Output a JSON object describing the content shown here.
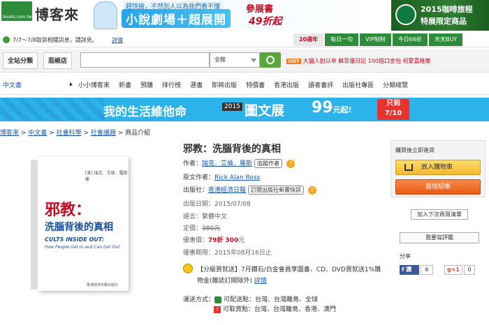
{
  "header": {
    "logo_small": "books.com.tw",
    "logo_text": "博客來",
    "promo_line1": "趕快搶，不然別人以為我們看不懂",
    "promo_line2": "小說劇場＋超展開",
    "promo_right1": "參展書",
    "promo_right2": "49折起",
    "starbucks_line1": "2015咖啡旅程",
    "starbucks_line2": "特展限定商品"
  },
  "notice": {
    "text": "7/7～7/8取貨相關訊息，請詳見。",
    "link": "詳情"
  },
  "toplinks": [
    "20週年",
    "每日一句",
    "VIP制制",
    "今日66折",
    "天天BUY"
  ],
  "search": {
    "category_button": "全站分類",
    "store_button": "逛帳店",
    "scope": "全館",
    "hot_label": "HOT",
    "hot_links": "大貓人創以帝  蘇菲僵日記  100個口金包  柯蒙嘉雞樂"
  },
  "nav": {
    "first": "中文書",
    "items": [
      "小小博客來",
      "新書",
      "預購",
      "排行榜",
      "選書",
      "即將出版",
      "特價書",
      "香港出版",
      "讀者書評",
      "出版社專區",
      "分類總覽"
    ]
  },
  "promo_banner": {
    "text1": "我的生活維他命",
    "year": "2015",
    "text2": "圖文展",
    "text3": "99",
    "text3_suffix": "元起!",
    "badge": "只到 7/10"
  },
  "breadcrumb": {
    "items": [
      "博客來",
      "中文書",
      "社會科學",
      "社會議題"
    ],
    "current": "商品介紹"
  },
  "book_cover": {
    "author_mini": "[美] 瑞克．艾倫．羅斯 著",
    "title_cn": "邪教：",
    "subtitle_cn": "洗腦背後的真相",
    "title_en": "CULTS INSIDE OUT:",
    "subtitle_en": "How People Get In and Can Get Out",
    "publisher_mini": "香港經濟日報出版社"
  },
  "product": {
    "title": "邪教：洗腦背後的真相",
    "author_label": "作者：",
    "author": "瑞克．艾倫．羅斯",
    "track_author": "追蹤作者",
    "original_author_label": "原文作者：",
    "original_author": "Rick Alan Ross",
    "publisher_label": "出版社：",
    "publisher": "香港經濟日報",
    "subscribe_publisher": "訂閱出版社新書快訊",
    "date_label": "出版日期：",
    "date": "2015/07/08",
    "language_label": "語言：",
    "language": "繁體中文",
    "list_price_label": "定價：",
    "list_price": "380元",
    "sale_label": "優惠價：",
    "sale_discount": "79折",
    "sale_price": "300",
    "sale_unit": "元",
    "promo_period_label": "優惠期限：",
    "promo_period": "2015年08月16日止",
    "promo_note": "【分級買就送】7月鑽石/白金會員享圖書、CD、DVD買就送1%購物金(雜誌訂閱除外)",
    "promo_link": "詳情",
    "shipping_label": "運送方式：",
    "shipping_home": "可配送點：台灣、台灣離島、全球",
    "shipping_711": "可取貨點：台灣、台灣離島、香港、澳門"
  },
  "cart": {
    "header": "購買後立即進貨",
    "add_to_cart": "放入購物車",
    "buy_now": "直接結帳",
    "wishlist": "加入下次再買清單",
    "review": "我要寫評鑑",
    "share_label": "分享",
    "fb_label": "讚",
    "fb_count": "6",
    "gplus_label": "g+1",
    "gplus_count": "0"
  },
  "colors": {
    "brand_green": "#2e8b3a",
    "link_blue": "#1a59a8",
    "price_red": "#c30d23",
    "buy_orange": "#e85a14"
  }
}
